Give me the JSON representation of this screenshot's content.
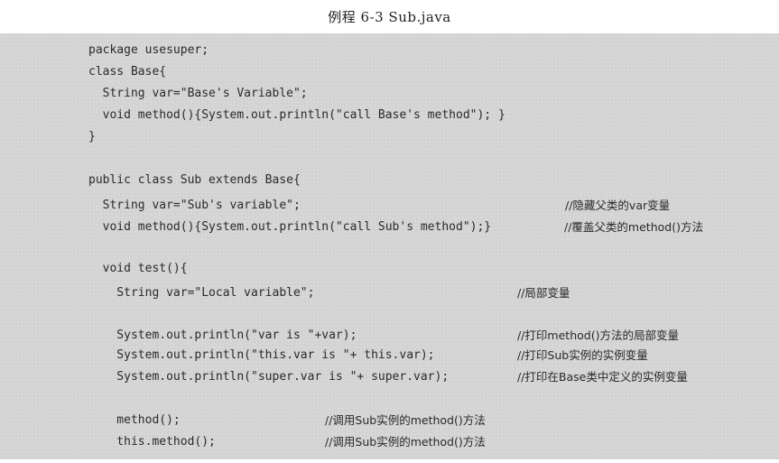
{
  "caption": "例程 6-3    Sub.java",
  "code_lines": [
    "package usesuper;",
    "class Base{",
    "  String var=\"Base's Variable\";",
    "  void method(){System.out.println(\"call Base's method\"); }",
    "}",
    "public class Sub extends Base{",
    "  String var=\"Sub's variable\";",
    "  void method(){System.out.println(\"call Sub's method\");}",
    "  void test(){",
    "    String var=\"Local variable\";",
    "    System.out.println(\"var is \"+var);",
    "    System.out.println(\"this.var is \"+ this.var);",
    "    System.out.println(\"super.var is \"+ super.var);",
    "    method();",
    "    this.method();"
  ],
  "comments": [
    "//隐藏父类的var变量",
    "//覆盖父类的method()方法",
    "//局部变量",
    "//打印method()方法的局部变量",
    "//打印Sub实例的实例变量",
    "//打印在Base类中定义的实例变量",
    "//调用Sub实例的method()方法",
    "//调用Sub实例的method()方法"
  ]
}
